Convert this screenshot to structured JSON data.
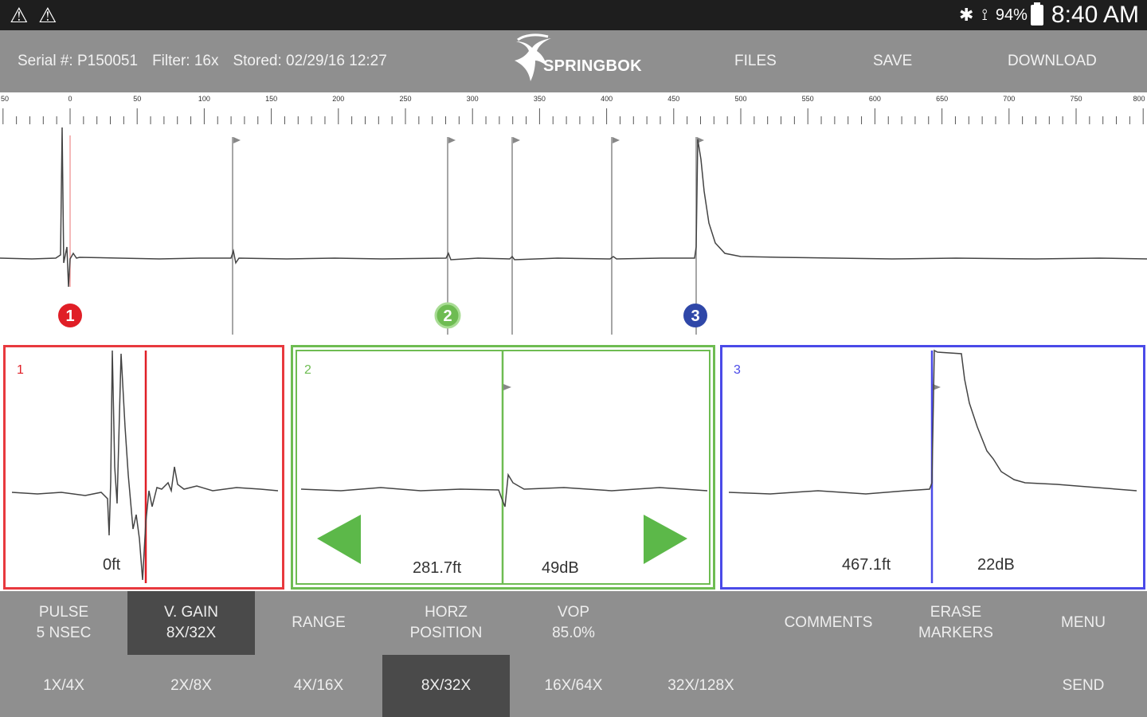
{
  "status_bar": {
    "warning_icons": [
      "warning-icon",
      "warning-icon"
    ],
    "battery_percent": "94%",
    "time": "8:40 AM"
  },
  "header": {
    "serial": "Serial #: P150051",
    "filter": "Filter: 16x",
    "stored": "Stored: 02/29/16 12:27",
    "logo_text": "SPRINGBOK",
    "files_label": "FILES",
    "save_label": "SAVE",
    "download_label": "DOWNLOAD"
  },
  "ruler": {
    "labels": [
      "50",
      "0",
      "50",
      "100",
      "150",
      "200",
      "250",
      "300",
      "350",
      "400",
      "450",
      "500",
      "550",
      "600",
      "650",
      "700",
      "750",
      "800"
    ]
  },
  "markers": [
    {
      "id": "1",
      "color": "#e01e26"
    },
    {
      "id": "2",
      "color": "#6ebc52"
    },
    {
      "id": "3",
      "color": "#2f47a8"
    }
  ],
  "panels": [
    {
      "number": "1",
      "distance": "0ft",
      "gain": ""
    },
    {
      "number": "2",
      "distance": "281.7ft",
      "gain": "49dB"
    },
    {
      "number": "3",
      "distance": "467.1ft",
      "gain": "22dB"
    }
  ],
  "toolbar_top": [
    {
      "line1": "PULSE",
      "line2": "5 NSEC",
      "active": false
    },
    {
      "line1": "V. GAIN",
      "line2": "8X/32X",
      "active": true
    },
    {
      "line1": "RANGE",
      "line2": "",
      "active": false
    },
    {
      "line1": "HORZ",
      "line2": "POSITION",
      "active": false
    },
    {
      "line1": "VOP",
      "line2": "85.0%",
      "active": false
    },
    {
      "line1": "",
      "line2": "",
      "active": false
    },
    {
      "line1": "COMMENTS",
      "line2": "",
      "active": false
    },
    {
      "line1": "ERASE",
      "line2": "MARKERS",
      "active": false
    },
    {
      "line1": "MENU",
      "line2": "",
      "active": false
    }
  ],
  "toolbar_bottom": [
    {
      "label": "1X/4X",
      "active": false
    },
    {
      "label": "2X/8X",
      "active": false
    },
    {
      "label": "4X/16X",
      "active": false
    },
    {
      "label": "8X/32X",
      "active": true
    },
    {
      "label": "16X/64X",
      "active": false
    },
    {
      "label": "32X/128X",
      "active": false
    },
    {
      "label": "",
      "active": false
    },
    {
      "label": "",
      "active": false
    },
    {
      "label": "SEND",
      "active": false
    }
  ],
  "colors": {
    "marker1": "#e01e26",
    "marker2": "#6ebc52",
    "marker3": "#2f47a8",
    "toolbar": "#8f8f8f",
    "active": "#4a4a4a"
  }
}
